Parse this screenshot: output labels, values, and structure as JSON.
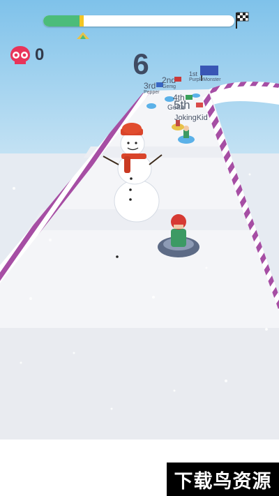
{
  "hud": {
    "progress": 0.2,
    "kills": "0",
    "rank": "6",
    "icons": [
      "skull-icon",
      "finish-flag-icon",
      "direction-arrow-icon"
    ],
    "colors": {
      "progress_fill": "#4cbc7a",
      "progress_marker": "#f3c623",
      "skull": "#e8345a",
      "rank_text": "#3f4b63"
    }
  },
  "racers": {
    "third_place": "3rd",
    "third_name": "Pepper",
    "second_place": "2nd",
    "second_name": "Gemg",
    "first_place": "1st",
    "first_name": "PurpleMonster",
    "fourth_place": "4th",
    "fourth_name": "Gotta",
    "fifth_place": "5th",
    "fifth_name": "JokingKid"
  },
  "watermark": "下载鸟资源"
}
